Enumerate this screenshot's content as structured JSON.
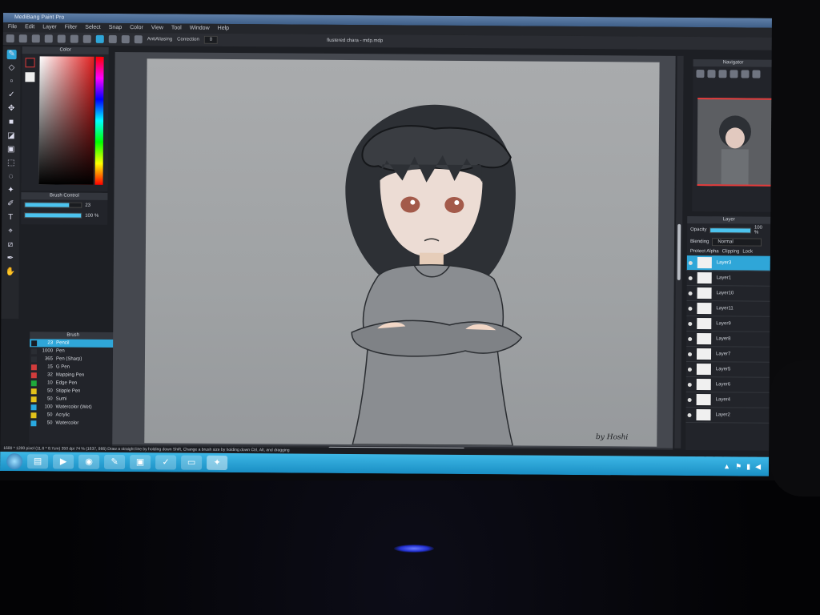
{
  "window": {
    "title": "MediBang Paint Pro"
  },
  "menu": [
    "File",
    "Edit",
    "Layer",
    "Filter",
    "Select",
    "Snap",
    "Color",
    "View",
    "Tool",
    "Window",
    "Help"
  ],
  "toolbar": {
    "antialiasing_label": "AntiAliasing",
    "correction_label": "Correction",
    "correction_value": "0"
  },
  "document": {
    "tab_title": "flustered chara - mdp.mdp"
  },
  "panels": {
    "color": "Color",
    "brush_control": "Brush Control",
    "brush": "Brush",
    "navigator": "Navigator",
    "layer": "Layer"
  },
  "brush_control": {
    "size_value": "23",
    "opacity_value": "100 %",
    "size_fraction": 0.78,
    "opacity_fraction": 1.0
  },
  "brushes": [
    {
      "size": "23",
      "name": "Pencil",
      "color": "#1a1d24",
      "selected": true
    },
    {
      "size": "1000",
      "name": "Pen",
      "color": "#2a2d33"
    },
    {
      "size": "365",
      "name": "Pen (Sharp)",
      "color": "#2a2d33"
    },
    {
      "size": "15",
      "name": "G Pen",
      "color": "#d23c3c"
    },
    {
      "size": "32",
      "name": "Mapping Pen",
      "color": "#d23c3c"
    },
    {
      "size": "10",
      "name": "Edge Pen",
      "color": "#1faa3b"
    },
    {
      "size": "50",
      "name": "Stipple Pen",
      "color": "#e3c21a"
    },
    {
      "size": "50",
      "name": "Sumi",
      "color": "#e3c21a"
    },
    {
      "size": "100",
      "name": "Watercolor (Wet)",
      "color": "#29a9e0"
    },
    {
      "size": "50",
      "name": "Acrylic",
      "color": "#e3c21a"
    },
    {
      "size": "50",
      "name": "Watercolor",
      "color": "#29a9e0"
    }
  ],
  "layer_panel": {
    "opacity_label": "Opacity",
    "opacity_value": "100 %",
    "opacity_fraction": 1.0,
    "blending_label": "Blending",
    "blending_value": "Normal",
    "protect_alpha": "Protect Alpha",
    "clipping": "Clipping",
    "lock": "Lock",
    "layers": [
      "Layer3",
      "Layer1",
      "Layer10",
      "Layer11",
      "Layer9",
      "Layer8",
      "Layer7",
      "Layer5",
      "Layer6",
      "Layer4",
      "Layer2"
    ]
  },
  "signature": "by Hoshi",
  "status": {
    "size": "1600 * 1200 pixel   (11.6 * 8.7cm)",
    "dpi": "350 dpi",
    "zoom": "74 %",
    "coords": "(1637, 866)",
    "hint": "Draw a straight line by holding down Shift, Change a brush size by holding down Ctrl, Alt, and dragging"
  },
  "colors": {
    "accent": "#2fa6d8",
    "taskbar": "#1a8fc4",
    "navigator_frame": "#e23b3b"
  }
}
